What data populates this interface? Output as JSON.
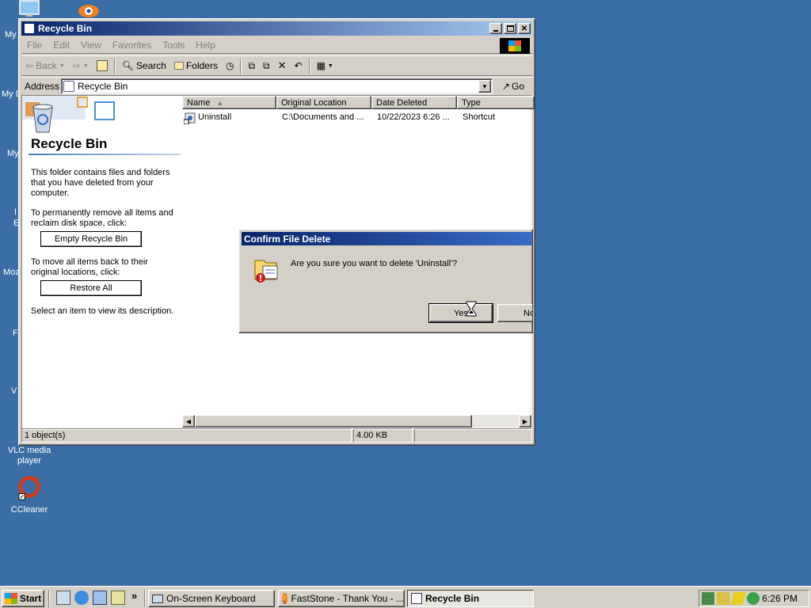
{
  "desktop": {
    "icons": [
      {
        "label": "VLC media player"
      },
      {
        "label": "CCleaner"
      }
    ],
    "fragments": [
      "My",
      "My D",
      "My",
      "I",
      "E",
      "Moz",
      "F",
      "V"
    ]
  },
  "window": {
    "title": "Recycle Bin",
    "menu": [
      "File",
      "Edit",
      "View",
      "Favorites",
      "Tools",
      "Help"
    ],
    "toolbar": {
      "back": "Back",
      "search": "Search",
      "folders": "Folders"
    },
    "address": {
      "label": "Address",
      "value": "Recycle Bin",
      "go": "Go"
    },
    "left_pane": {
      "title": "Recycle Bin",
      "desc": "This folder contains files and folders that you have deleted from your computer.",
      "remove_text": "To permanently remove all items and reclaim disk space, click:",
      "empty_button": "Empty Recycle Bin",
      "restore_text": "To move all items back to their original locations, click:",
      "restore_button": "Restore All",
      "select_text": "Select an item to view its description."
    },
    "columns": [
      "Name",
      "Original Location",
      "Date Deleted",
      "Type"
    ],
    "rows": [
      {
        "name": "Uninstall",
        "location": "C:\\Documents and ...",
        "date": "10/22/2023 6:26 ...",
        "type": "Shortcut"
      }
    ],
    "status": {
      "objects": "1 object(s)",
      "size": "4.00 KB"
    }
  },
  "dialog": {
    "title": "Confirm File Delete",
    "message": "Are you sure you want to delete 'Uninstall'?",
    "yes": "Yes",
    "no": "No"
  },
  "taskbar": {
    "start": "Start",
    "chevron": "»",
    "tasks": [
      {
        "label": "On-Screen Keyboard"
      },
      {
        "label": "FastStone - Thank You - ..."
      },
      {
        "label": "Recycle Bin"
      }
    ],
    "clock": "6:26 PM"
  },
  "colors": {
    "desktop": "#3a6ea5",
    "titlebar_start": "#0a246a",
    "titlebar_end": "#a6caf0",
    "face": "#d4d0c8"
  }
}
